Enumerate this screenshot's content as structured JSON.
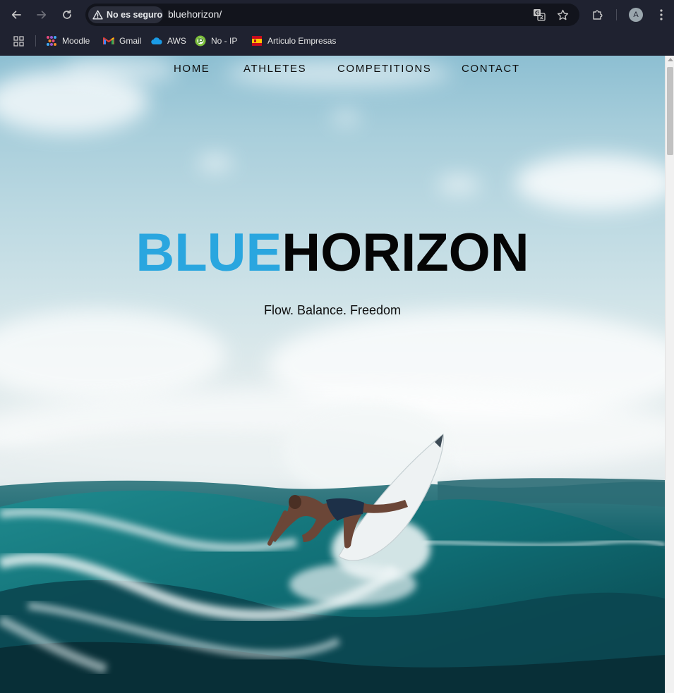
{
  "browser": {
    "security_label": "No es seguro",
    "url": "bluehorizon/",
    "profile_initial": "A",
    "bookmarks": [
      {
        "label": "Moodle",
        "icon": "moodle-icon"
      },
      {
        "label": "Gmail",
        "icon": "gmail-icon"
      },
      {
        "label": "AWS",
        "icon": "aws-cloud-icon"
      },
      {
        "label": "No -  IP",
        "icon": "noip-icon"
      },
      {
        "label": "Articulo Empresas",
        "icon": "flag-icon"
      }
    ]
  },
  "site": {
    "nav": [
      "HOME",
      "ATHLETES",
      "COMPETITIONS",
      "CONTACT"
    ],
    "brand_primary": "BLUE",
    "brand_secondary": "HORIZON",
    "tagline": "Flow. Balance. Freedom"
  },
  "colors": {
    "chrome_bg": "#1f2230",
    "omnibox_bg": "#12141c",
    "brand_blue": "#2aa6df",
    "brand_dark": "#050505",
    "ocean": "#0f5a63"
  }
}
